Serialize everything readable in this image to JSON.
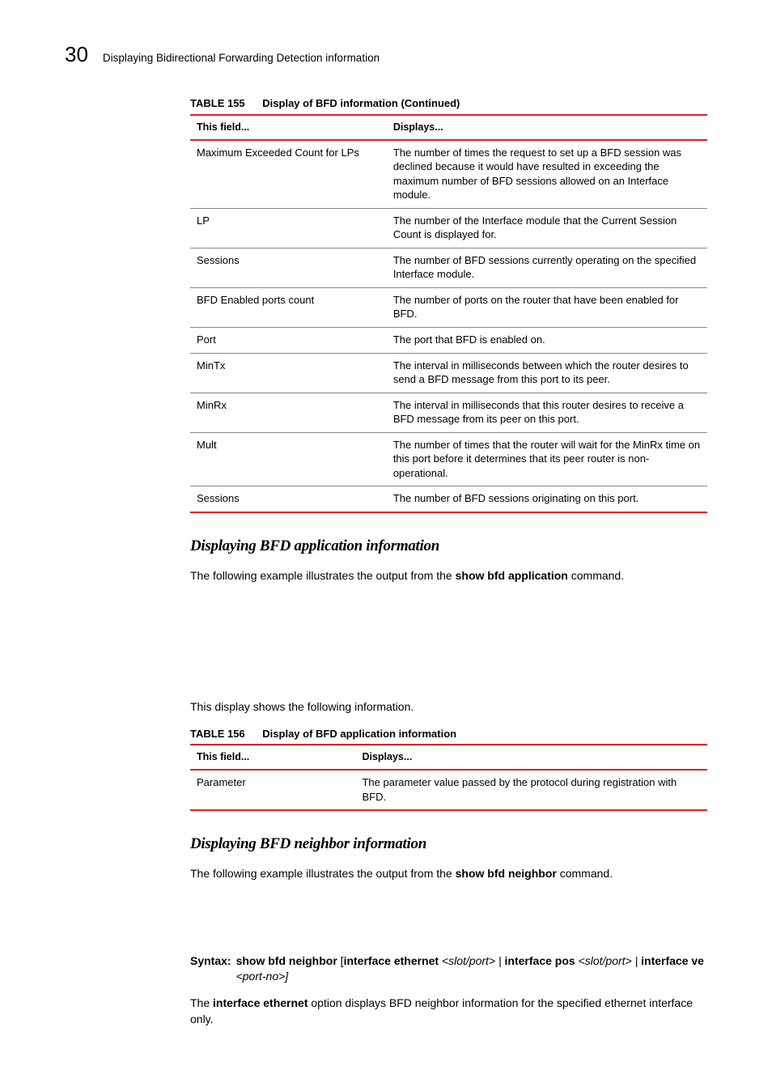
{
  "header": {
    "page_number": "30",
    "title": "Displaying Bidirectional Forwarding Detection information"
  },
  "table155": {
    "caption_label": "TABLE 155",
    "caption": "Display of BFD information  (Continued)",
    "col1": "This field...",
    "col2": "Displays...",
    "rows": [
      {
        "field": "Maximum Exceeded Count for LPs",
        "indent": 2,
        "desc": "The number of times the request to set up a BFD session was declined because it would have resulted in exceeding the maximum number of BFD sessions allowed on an Interface module."
      },
      {
        "field": "LP",
        "indent": 2,
        "desc": "The number of the Interface module that the Current Session Count is displayed for."
      },
      {
        "field": "Sessions",
        "indent": 2,
        "desc": "The number of BFD sessions currently operating on the specified Interface module."
      },
      {
        "field": "BFD Enabled ports count",
        "indent": 0,
        "desc": "The number of ports on the router that have been enabled for BFD."
      },
      {
        "field": "Port",
        "indent": 1,
        "desc": "The port that BFD is enabled on."
      },
      {
        "field": "MinTx",
        "indent": 1,
        "desc": "The interval in milliseconds between which the router desires to send a BFD message from this port to its peer."
      },
      {
        "field": "MinRx",
        "indent": 1,
        "desc": "The interval in milliseconds that this router desires to receive a BFD message from its peer on this port."
      },
      {
        "field": "Mult",
        "indent": 1,
        "desc": "The number of times that the router will wait for the MinRx time on this port before it determines that its peer router is non-operational."
      },
      {
        "field": "Sessions",
        "indent": 1,
        "desc": "The number of BFD sessions originating on this port."
      }
    ]
  },
  "section1": {
    "heading": "Displaying BFD application information",
    "para_pre": "The following example illustrates the output from the ",
    "para_bold": "show bfd application",
    "para_post": " command.",
    "para2": "This display shows the following information."
  },
  "table156": {
    "caption_label": "TABLE 156",
    "caption": "Display of BFD application information",
    "col1": "This field...",
    "col2": "Displays...",
    "rows": [
      {
        "field": "Parameter",
        "desc": "The parameter value passed by the protocol during registration with BFD."
      }
    ]
  },
  "section2": {
    "heading": "Displaying BFD neighbor information",
    "para_pre": "The following example illustrates the output from the ",
    "para_bold": "show bfd neighbor",
    "para_post": " command."
  },
  "syntax": {
    "label": "Syntax:",
    "p1": "show bfd neighbor",
    "p2": " [",
    "p3": "interface ethernet",
    "p4": " <slot/port> | ",
    "p5": "interface pos",
    "p6": " <slot/port> | ",
    "p7": "interface ve",
    "p8": " <port-no>]"
  },
  "section2_para2": {
    "pre": "The ",
    "bold": "interface ethernet",
    "post": " option displays BFD neighbor information for the specified ethernet interface only."
  }
}
